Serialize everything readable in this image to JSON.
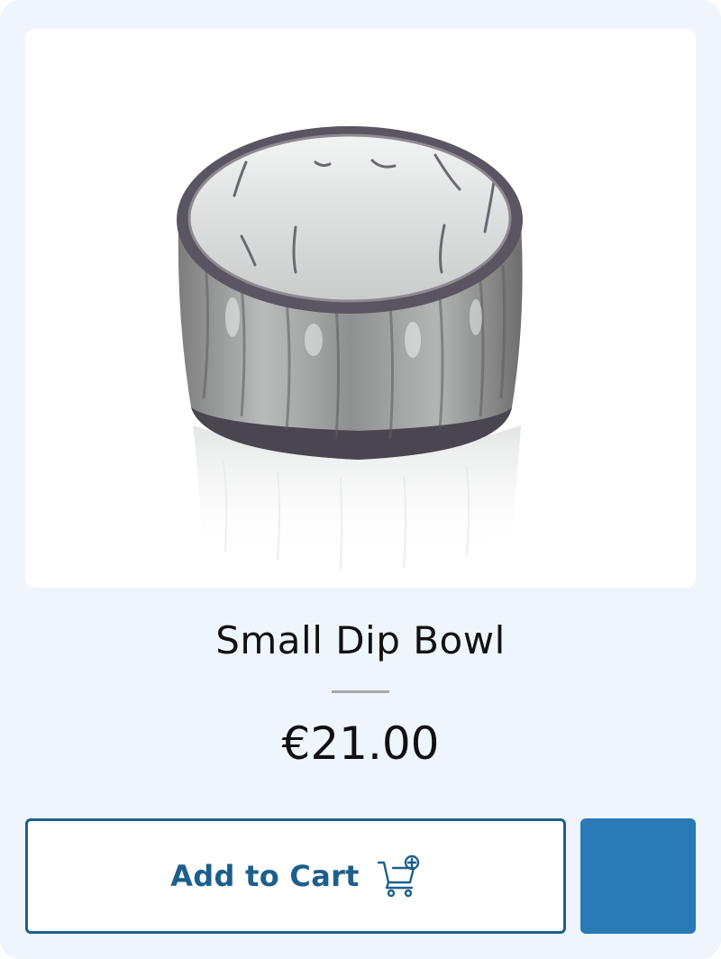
{
  "product": {
    "title": "Small Dip Bowl",
    "price": "€21.00",
    "image_alt": "Small Dip Bowl"
  },
  "actions": {
    "add_to_cart_label": "Add to Cart",
    "add_to_cart_icon": "cart-add-icon"
  },
  "colors": {
    "card_background": "#eef5fc",
    "accent": "#1d5f8c",
    "secondary_button": "#2a7ab8"
  }
}
